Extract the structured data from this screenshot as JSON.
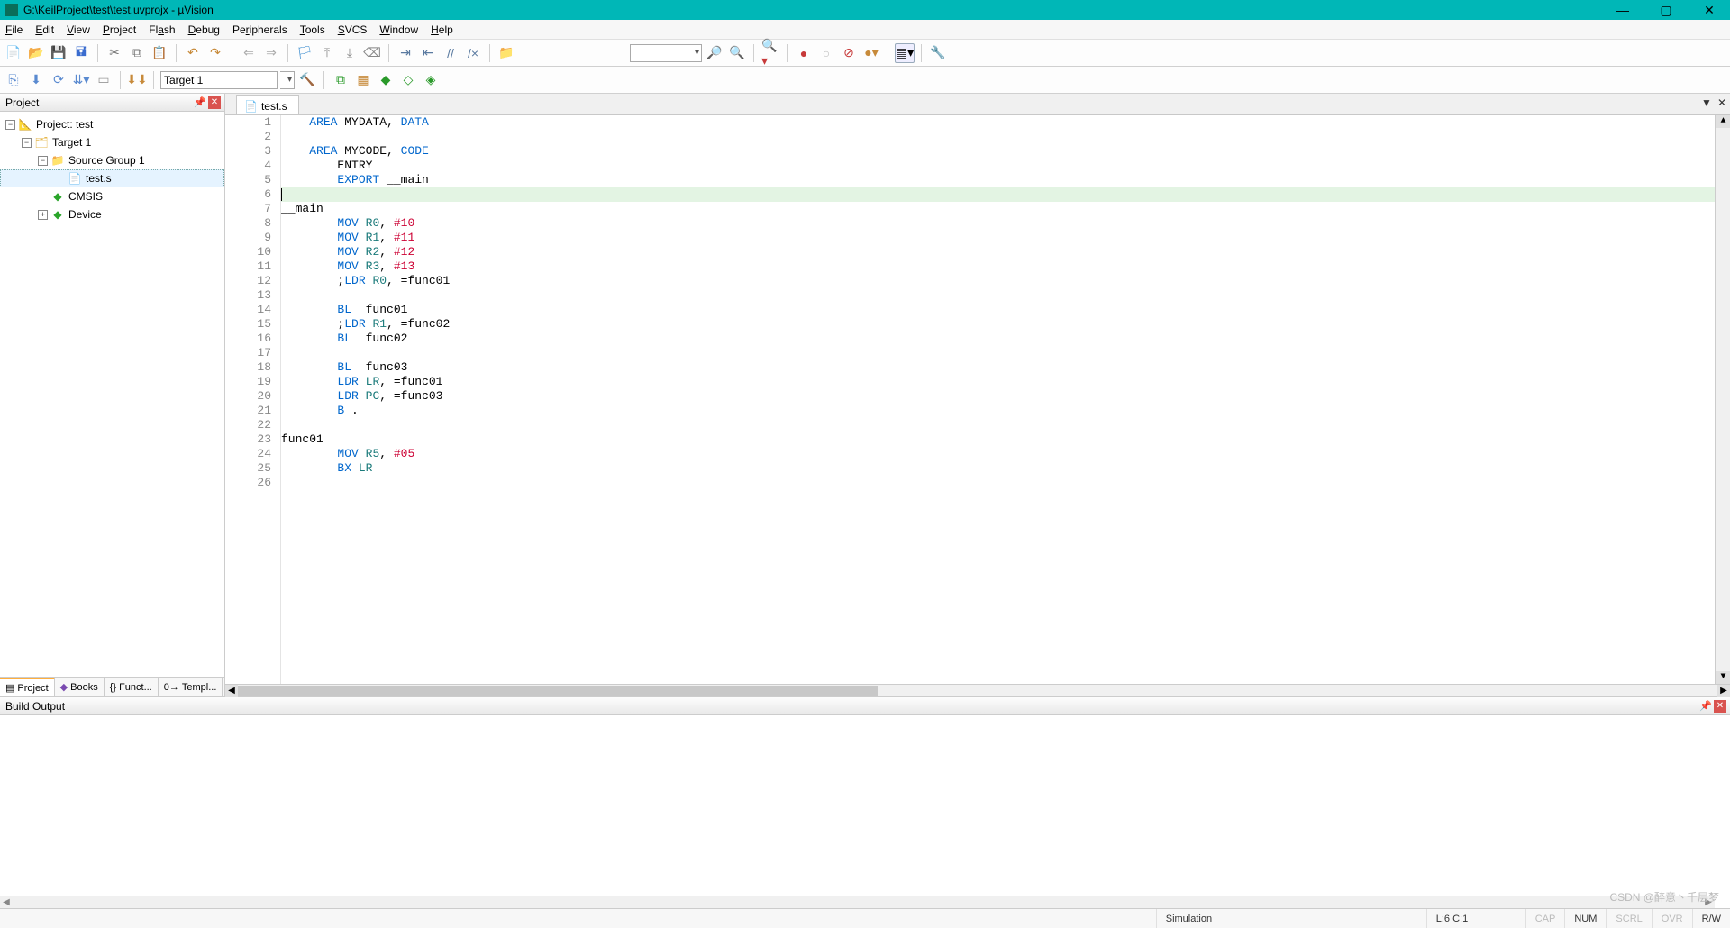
{
  "window": {
    "title": "G:\\KeilProject\\test\\test.uvprojx - µVision",
    "min": "—",
    "max": "▢",
    "close": "✕"
  },
  "menu": [
    "File",
    "Edit",
    "View",
    "Project",
    "Flash",
    "Debug",
    "Peripherals",
    "Tools",
    "SVCS",
    "Window",
    "Help"
  ],
  "toolbar2": {
    "target": "Target 1"
  },
  "project_panel": {
    "title": "Project",
    "tree": {
      "root": "Project: test",
      "target": "Target 1",
      "group": "Source Group 1",
      "file": "test.s",
      "cmsis": "CMSIS",
      "device": "Device"
    },
    "tabs": [
      "Project",
      "Books",
      "Funct...",
      "Templ..."
    ]
  },
  "editor": {
    "tab": "test.s",
    "lines": [
      {
        "n": 1,
        "tokens": [
          [
            "    ",
            "txt"
          ],
          [
            "AREA",
            "kw-blue"
          ],
          [
            " MYDATA, ",
            "txt"
          ],
          [
            "DATA",
            "kw-blue"
          ]
        ]
      },
      {
        "n": 2,
        "tokens": []
      },
      {
        "n": 3,
        "tokens": [
          [
            "    ",
            "txt"
          ],
          [
            "AREA",
            "kw-blue"
          ],
          [
            " MYCODE, ",
            "txt"
          ],
          [
            "CODE",
            "kw-blue"
          ]
        ]
      },
      {
        "n": 4,
        "tokens": [
          [
            "        ",
            "txt"
          ],
          [
            "ENTRY",
            "txt"
          ]
        ]
      },
      {
        "n": 5,
        "tokens": [
          [
            "        ",
            "txt"
          ],
          [
            "EXPORT",
            "kw-blue"
          ],
          [
            " __main",
            "txt"
          ]
        ]
      },
      {
        "n": 6,
        "tokens": [],
        "highlight": true,
        "cursor": true
      },
      {
        "n": 7,
        "tokens": [
          [
            "__main",
            "lblt"
          ]
        ]
      },
      {
        "n": 8,
        "tokens": [
          [
            "        ",
            "txt"
          ],
          [
            "MOV",
            "kw-blue"
          ],
          [
            " ",
            "txt"
          ],
          [
            "R0",
            "reg"
          ],
          [
            ", ",
            "txt"
          ],
          [
            "#10",
            "num"
          ]
        ]
      },
      {
        "n": 9,
        "tokens": [
          [
            "        ",
            "txt"
          ],
          [
            "MOV",
            "kw-blue"
          ],
          [
            " ",
            "txt"
          ],
          [
            "R1",
            "reg"
          ],
          [
            ", ",
            "txt"
          ],
          [
            "#11",
            "num"
          ]
        ]
      },
      {
        "n": 10,
        "tokens": [
          [
            "        ",
            "txt"
          ],
          [
            "MOV",
            "kw-blue"
          ],
          [
            " ",
            "txt"
          ],
          [
            "R2",
            "reg"
          ],
          [
            ", ",
            "txt"
          ],
          [
            "#12",
            "num"
          ]
        ]
      },
      {
        "n": 11,
        "tokens": [
          [
            "        ",
            "txt"
          ],
          [
            "MOV",
            "kw-blue"
          ],
          [
            " ",
            "txt"
          ],
          [
            "R3",
            "reg"
          ],
          [
            ", ",
            "txt"
          ],
          [
            "#13",
            "num"
          ]
        ]
      },
      {
        "n": 12,
        "tokens": [
          [
            "        ;",
            "txt"
          ],
          [
            "LDR",
            "kw-blue"
          ],
          [
            " ",
            "txt"
          ],
          [
            "R0",
            "reg"
          ],
          [
            ", =func01",
            "txt"
          ]
        ]
      },
      {
        "n": 13,
        "tokens": []
      },
      {
        "n": 14,
        "tokens": [
          [
            "        ",
            "txt"
          ],
          [
            "BL",
            "kw-blue"
          ],
          [
            "  func01",
            "txt"
          ]
        ]
      },
      {
        "n": 15,
        "tokens": [
          [
            "        ;",
            "txt"
          ],
          [
            "LDR",
            "kw-blue"
          ],
          [
            " ",
            "txt"
          ],
          [
            "R1",
            "reg"
          ],
          [
            ", =func02",
            "txt"
          ]
        ]
      },
      {
        "n": 16,
        "tokens": [
          [
            "        ",
            "txt"
          ],
          [
            "BL",
            "kw-blue"
          ],
          [
            "  func02",
            "txt"
          ]
        ]
      },
      {
        "n": 17,
        "tokens": []
      },
      {
        "n": 18,
        "tokens": [
          [
            "        ",
            "txt"
          ],
          [
            "BL",
            "kw-blue"
          ],
          [
            "  func03",
            "txt"
          ]
        ]
      },
      {
        "n": 19,
        "tokens": [
          [
            "        ",
            "txt"
          ],
          [
            "LDR",
            "kw-blue"
          ],
          [
            " ",
            "txt"
          ],
          [
            "LR",
            "reg"
          ],
          [
            ", =func01",
            "txt"
          ]
        ]
      },
      {
        "n": 20,
        "tokens": [
          [
            "        ",
            "txt"
          ],
          [
            "LDR",
            "kw-blue"
          ],
          [
            " ",
            "txt"
          ],
          [
            "PC",
            "reg"
          ],
          [
            ", =func03",
            "txt"
          ]
        ]
      },
      {
        "n": 21,
        "tokens": [
          [
            "        ",
            "txt"
          ],
          [
            "B",
            "kw-blue"
          ],
          [
            " .",
            "txt"
          ]
        ]
      },
      {
        "n": 22,
        "tokens": []
      },
      {
        "n": 23,
        "tokens": [
          [
            "func01",
            "lblt"
          ]
        ]
      },
      {
        "n": 24,
        "tokens": [
          [
            "        ",
            "txt"
          ],
          [
            "MOV",
            "kw-blue"
          ],
          [
            " ",
            "txt"
          ],
          [
            "R5",
            "reg"
          ],
          [
            ", ",
            "txt"
          ],
          [
            "#05",
            "num"
          ]
        ]
      },
      {
        "n": 25,
        "tokens": [
          [
            "        ",
            "txt"
          ],
          [
            "BX",
            "kw-blue"
          ],
          [
            " ",
            "txt"
          ],
          [
            "LR",
            "reg"
          ]
        ]
      },
      {
        "n": 26,
        "tokens": []
      }
    ]
  },
  "build_output": {
    "title": "Build Output"
  },
  "status": {
    "sim": "Simulation",
    "pos": "L:6 C:1",
    "cap": "CAP",
    "num": "NUM",
    "scrl": "SCRL",
    "ovr": "OVR",
    "rw": "R/W",
    "watermark": "CSDN @醉意丶千层梦"
  }
}
